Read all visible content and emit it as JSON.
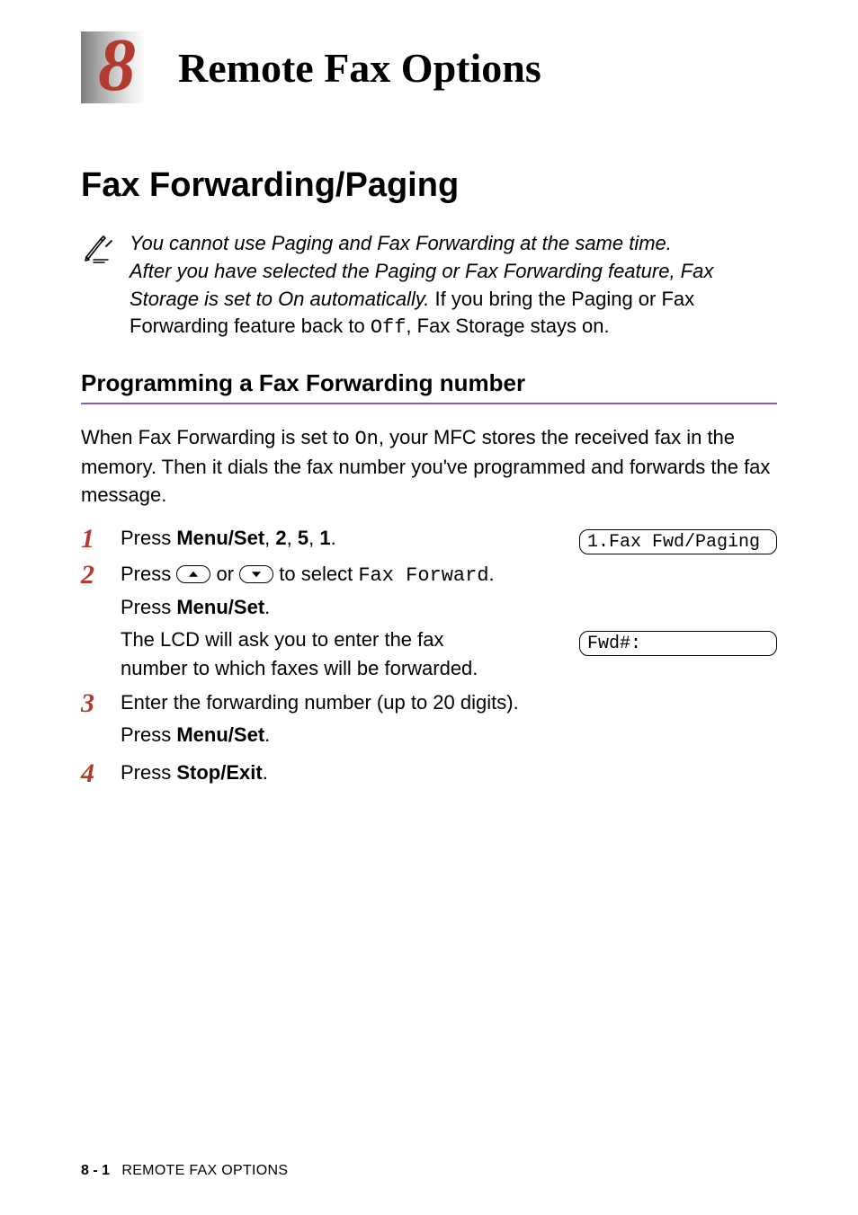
{
  "chapter": {
    "number": "8",
    "title": "Remote Fax Options"
  },
  "h1": "Fax Forwarding/Paging",
  "note": {
    "line1_italic": "You cannot use Paging and Fax Forwarding at the same time.",
    "line2_italic_a": "After you have selected the Paging or Fax Forwarding feature, Fax Storage is set to On automatically.",
    "line2_plain_a": " If you bring the Paging or Fax Forwarding feature back to ",
    "line2_mono": "Off",
    "line2_plain_b": ", Fax Storage stays on."
  },
  "h2": "Programming a Fax Forwarding number",
  "intro": {
    "a": "When Fax Forwarding is set to ",
    "mono": "On",
    "b": ", your MFC stores the received fax in the memory. Then it dials the fax number you've programmed and forwards the fax message."
  },
  "steps": {
    "s1": {
      "num": "1",
      "a": "Press ",
      "b_bold": "Menu/Set",
      "c": ", ",
      "d_bold": "2",
      "e": ", ",
      "f_bold": "5",
      "g": ", ",
      "h_bold": "1",
      "i": ".",
      "lcd": "1.Fax Fwd/Paging"
    },
    "s2": {
      "num": "2",
      "l1_a": "Press ",
      "l1_b": " or ",
      "l1_c": " to select ",
      "l1_mono": "Fax Forward",
      "l1_d": ".",
      "l2_a": "Press ",
      "l2_bold": "Menu/Set",
      "l2_b": ".",
      "l3": "The LCD will ask you to enter the fax number to which faxes will be forwarded.",
      "lcd": "Fwd#:"
    },
    "s3": {
      "num": "3",
      "l1": "Enter the forwarding number (up to 20 digits).",
      "l2_a": "Press ",
      "l2_bold": "Menu/Set",
      "l2_b": "."
    },
    "s4": {
      "num": "4",
      "a": "Press ",
      "b_bold": "Stop/Exit",
      "c": "."
    }
  },
  "footer": {
    "page": "8 - 1",
    "section": "REMOTE FAX OPTIONS"
  }
}
